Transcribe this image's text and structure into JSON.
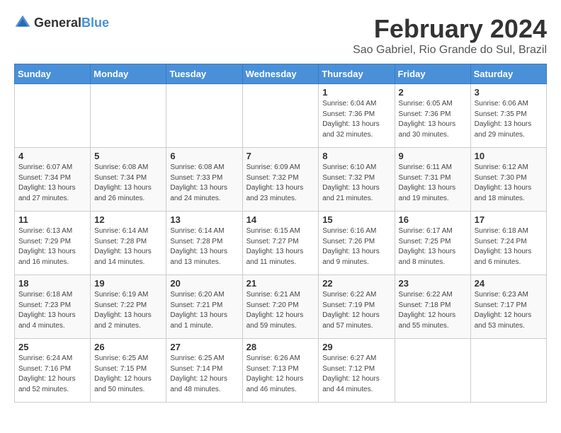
{
  "header": {
    "logo_general": "General",
    "logo_blue": "Blue",
    "month_year": "February 2024",
    "location": "Sao Gabriel, Rio Grande do Sul, Brazil"
  },
  "weekdays": [
    "Sunday",
    "Monday",
    "Tuesday",
    "Wednesday",
    "Thursday",
    "Friday",
    "Saturday"
  ],
  "weeks": [
    [
      {
        "day": "",
        "info": ""
      },
      {
        "day": "",
        "info": ""
      },
      {
        "day": "",
        "info": ""
      },
      {
        "day": "",
        "info": ""
      },
      {
        "day": "1",
        "info": "Sunrise: 6:04 AM\nSunset: 7:36 PM\nDaylight: 13 hours\nand 32 minutes."
      },
      {
        "day": "2",
        "info": "Sunrise: 6:05 AM\nSunset: 7:36 PM\nDaylight: 13 hours\nand 30 minutes."
      },
      {
        "day": "3",
        "info": "Sunrise: 6:06 AM\nSunset: 7:35 PM\nDaylight: 13 hours\nand 29 minutes."
      }
    ],
    [
      {
        "day": "4",
        "info": "Sunrise: 6:07 AM\nSunset: 7:34 PM\nDaylight: 13 hours\nand 27 minutes."
      },
      {
        "day": "5",
        "info": "Sunrise: 6:08 AM\nSunset: 7:34 PM\nDaylight: 13 hours\nand 26 minutes."
      },
      {
        "day": "6",
        "info": "Sunrise: 6:08 AM\nSunset: 7:33 PM\nDaylight: 13 hours\nand 24 minutes."
      },
      {
        "day": "7",
        "info": "Sunrise: 6:09 AM\nSunset: 7:32 PM\nDaylight: 13 hours\nand 23 minutes."
      },
      {
        "day": "8",
        "info": "Sunrise: 6:10 AM\nSunset: 7:32 PM\nDaylight: 13 hours\nand 21 minutes."
      },
      {
        "day": "9",
        "info": "Sunrise: 6:11 AM\nSunset: 7:31 PM\nDaylight: 13 hours\nand 19 minutes."
      },
      {
        "day": "10",
        "info": "Sunrise: 6:12 AM\nSunset: 7:30 PM\nDaylight: 13 hours\nand 18 minutes."
      }
    ],
    [
      {
        "day": "11",
        "info": "Sunrise: 6:13 AM\nSunset: 7:29 PM\nDaylight: 13 hours\nand 16 minutes."
      },
      {
        "day": "12",
        "info": "Sunrise: 6:14 AM\nSunset: 7:28 PM\nDaylight: 13 hours\nand 14 minutes."
      },
      {
        "day": "13",
        "info": "Sunrise: 6:14 AM\nSunset: 7:28 PM\nDaylight: 13 hours\nand 13 minutes."
      },
      {
        "day": "14",
        "info": "Sunrise: 6:15 AM\nSunset: 7:27 PM\nDaylight: 13 hours\nand 11 minutes."
      },
      {
        "day": "15",
        "info": "Sunrise: 6:16 AM\nSunset: 7:26 PM\nDaylight: 13 hours\nand 9 minutes."
      },
      {
        "day": "16",
        "info": "Sunrise: 6:17 AM\nSunset: 7:25 PM\nDaylight: 13 hours\nand 8 minutes."
      },
      {
        "day": "17",
        "info": "Sunrise: 6:18 AM\nSunset: 7:24 PM\nDaylight: 13 hours\nand 6 minutes."
      }
    ],
    [
      {
        "day": "18",
        "info": "Sunrise: 6:18 AM\nSunset: 7:23 PM\nDaylight: 13 hours\nand 4 minutes."
      },
      {
        "day": "19",
        "info": "Sunrise: 6:19 AM\nSunset: 7:22 PM\nDaylight: 13 hours\nand 2 minutes."
      },
      {
        "day": "20",
        "info": "Sunrise: 6:20 AM\nSunset: 7:21 PM\nDaylight: 13 hours\nand 1 minute."
      },
      {
        "day": "21",
        "info": "Sunrise: 6:21 AM\nSunset: 7:20 PM\nDaylight: 12 hours\nand 59 minutes."
      },
      {
        "day": "22",
        "info": "Sunrise: 6:22 AM\nSunset: 7:19 PM\nDaylight: 12 hours\nand 57 minutes."
      },
      {
        "day": "23",
        "info": "Sunrise: 6:22 AM\nSunset: 7:18 PM\nDaylight: 12 hours\nand 55 minutes."
      },
      {
        "day": "24",
        "info": "Sunrise: 6:23 AM\nSunset: 7:17 PM\nDaylight: 12 hours\nand 53 minutes."
      }
    ],
    [
      {
        "day": "25",
        "info": "Sunrise: 6:24 AM\nSunset: 7:16 PM\nDaylight: 12 hours\nand 52 minutes."
      },
      {
        "day": "26",
        "info": "Sunrise: 6:25 AM\nSunset: 7:15 PM\nDaylight: 12 hours\nand 50 minutes."
      },
      {
        "day": "27",
        "info": "Sunrise: 6:25 AM\nSunset: 7:14 PM\nDaylight: 12 hours\nand 48 minutes."
      },
      {
        "day": "28",
        "info": "Sunrise: 6:26 AM\nSunset: 7:13 PM\nDaylight: 12 hours\nand 46 minutes."
      },
      {
        "day": "29",
        "info": "Sunrise: 6:27 AM\nSunset: 7:12 PM\nDaylight: 12 hours\nand 44 minutes."
      },
      {
        "day": "",
        "info": ""
      },
      {
        "day": "",
        "info": ""
      }
    ]
  ]
}
